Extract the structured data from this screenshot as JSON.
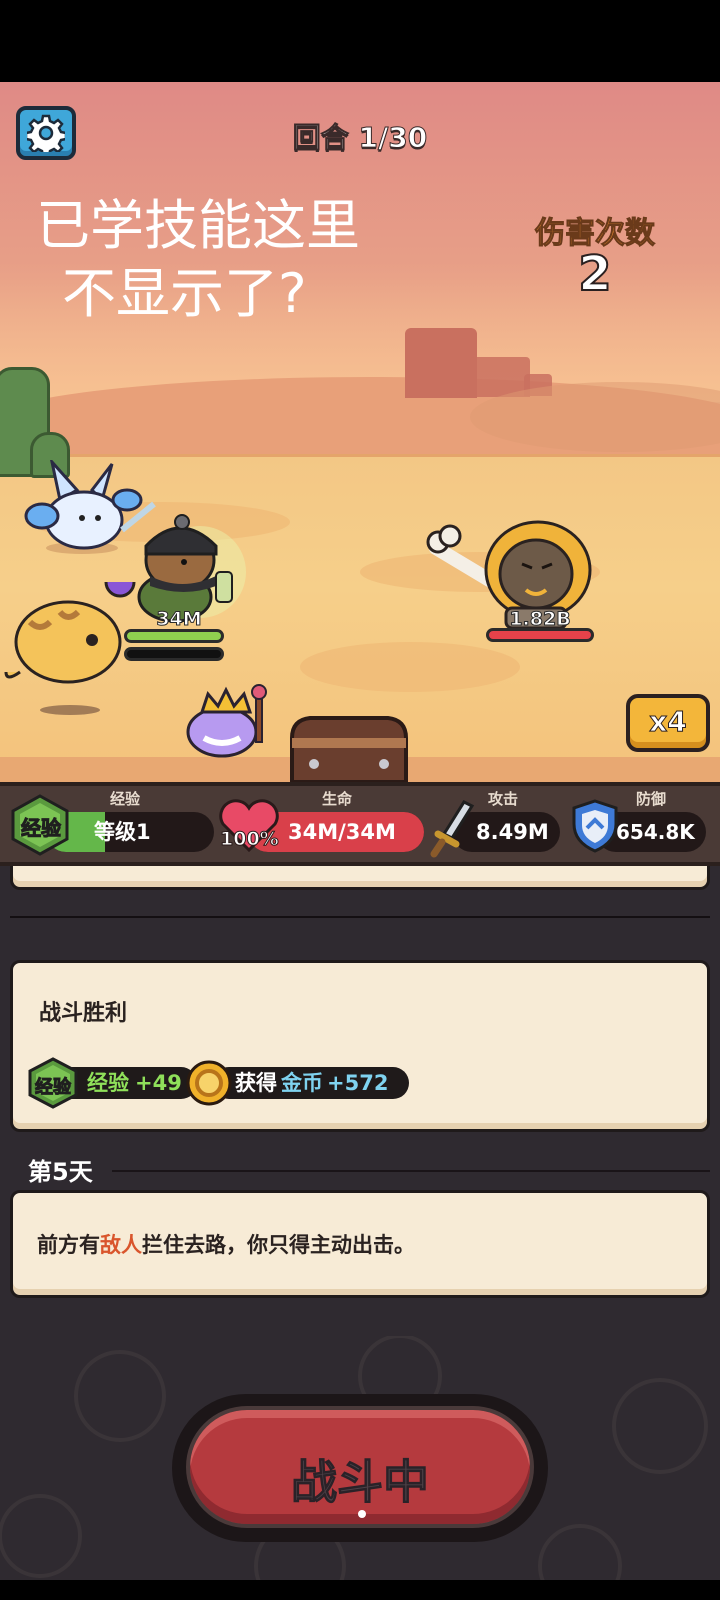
{
  "hud": {
    "round": "回合 1/30",
    "note_line1": "已学技能这里",
    "note_line2": "不显示了?",
    "hits_label": "伤害次数",
    "hits_value": "2",
    "speed": "x4"
  },
  "units": {
    "player_hp": "34M",
    "enemy_hp": "1.82B"
  },
  "stats": {
    "exp_label": "经验",
    "exp_badge": "经验",
    "level": "等级1",
    "exp_fraction": 0.35,
    "hp_label": "生命",
    "hp_percent": "100%",
    "hp_value": "34M/34M",
    "attack_label": "攻击",
    "attack_value": "8.49M",
    "defense_label": "防御",
    "defense_value": "654.8K"
  },
  "log": {
    "victory_title": "战斗胜利",
    "exp_badge": "经验",
    "exp_reward_prefix": "经验",
    "exp_reward_value": "+49",
    "gold_reward_prefix": "获得",
    "gold_reward_name": "金币",
    "gold_reward_value": "+572",
    "day_title": "第5天",
    "event_text_1": "前方有",
    "event_text_enemy": "敌人",
    "event_text_2": "拦住去路，你只得主动出击。"
  },
  "battle_button": "战斗中",
  "colors": {
    "accent_orange": "#e1842e",
    "exp_green": "#64b74a",
    "hp_red": "#d9404a",
    "gold_text": "#7fd3f0",
    "enemy_text": "#d9552c"
  }
}
